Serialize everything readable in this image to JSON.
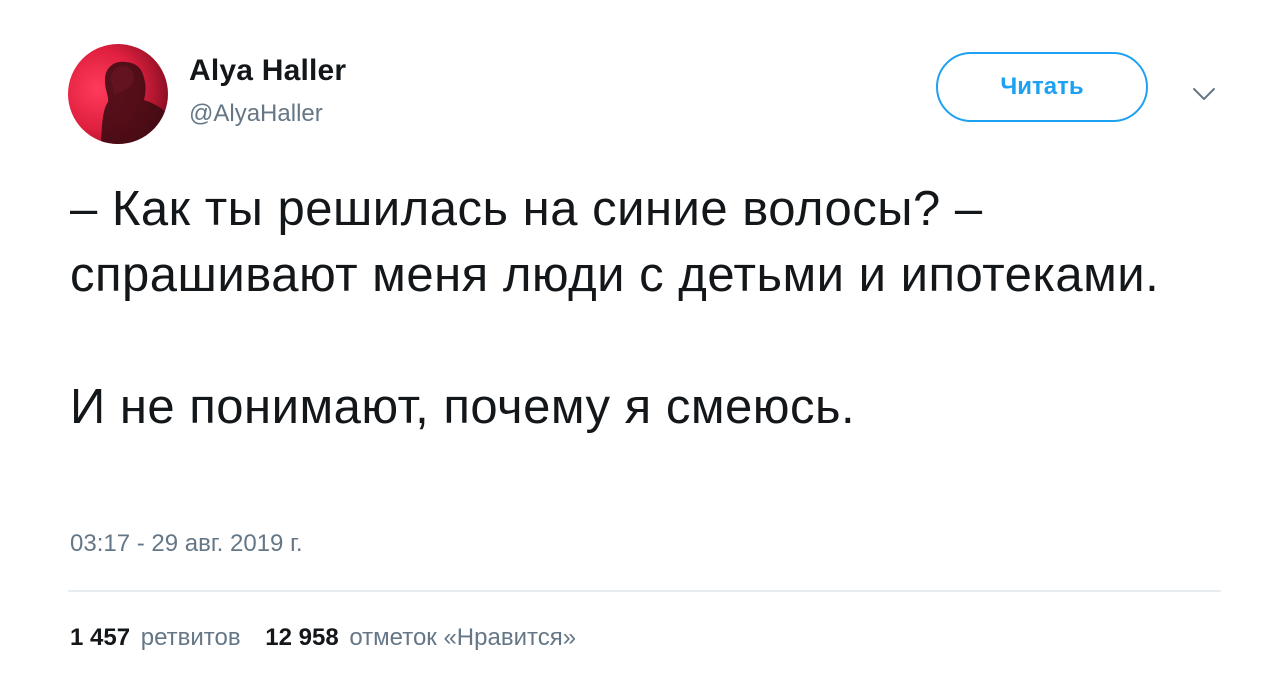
{
  "author": {
    "name": "Alya Haller",
    "handle": "@AlyaHaller"
  },
  "follow_button": {
    "label": "Читать"
  },
  "tweet": {
    "paragraphs": [
      "– Как ты решилась на синие волосы? – спрашивают меня люди с детьми и ипотеками.",
      "И не понимают, почему я смеюсь."
    ],
    "timestamp": "03:17 - 29 авг. 2019 г."
  },
  "stats": {
    "retweets_count": "1 457",
    "retweets_label": "ретвитов",
    "likes_count": "12 958",
    "likes_label": "отметок «Нравится»"
  },
  "icons": {
    "menu": "chevron-down-icon"
  },
  "colors": {
    "accent": "#1da1f2",
    "text": "#14171a",
    "secondary": "#657786",
    "divider": "#e6ecf0"
  }
}
